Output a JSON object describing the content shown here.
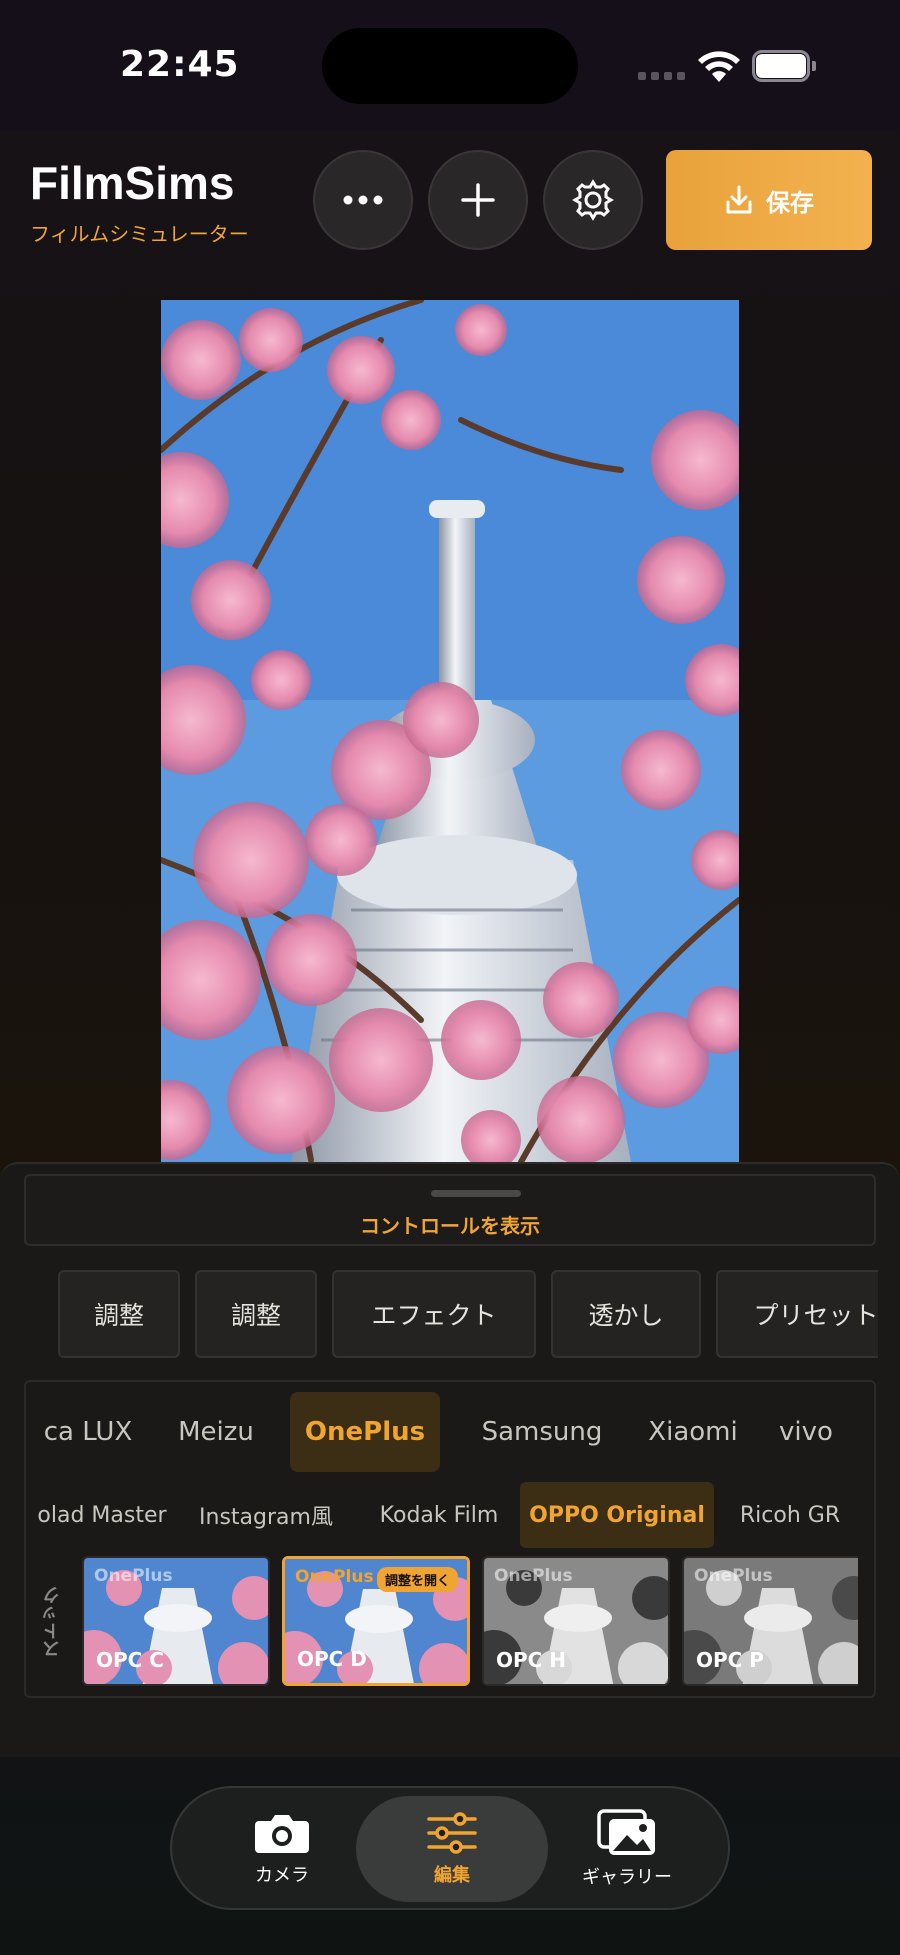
{
  "status": {
    "time": "22:45"
  },
  "header": {
    "title": "FilmSims",
    "subtitle": "フィルムシミュレーター",
    "save_label": "保存"
  },
  "icons": [
    "more-icon",
    "plus-icon",
    "gear-icon",
    "download-icon",
    "camera-icon",
    "sliders-icon",
    "gallery-icon"
  ],
  "controls": {
    "show_label": "コントロールを表示"
  },
  "tabs": [
    "調整",
    "調整",
    "エフェクト",
    "透かし",
    "プリセット"
  ],
  "brands": [
    "ca LUX",
    "Meizu",
    "OnePlus",
    "Samsung",
    "Xiaomi",
    "vivo"
  ],
  "brand_selected": "OnePlus",
  "categories": [
    "olad Master",
    "Instagram風",
    "Kodak Film",
    "OPPO Original",
    "Ricoh GR"
  ],
  "category_selected": "OPPO Original",
  "filters": {
    "label": "ストック",
    "open_badge": "調整を開く",
    "items": [
      {
        "brand": "OnePlus",
        "name": "OPC C"
      },
      {
        "brand": "OnePlus",
        "name": "OPC D"
      },
      {
        "brand": "OnePlus",
        "name": "OPC H"
      },
      {
        "brand": "OnePlus",
        "name": "OPC P"
      }
    ],
    "selected": "OPC D"
  },
  "nav": {
    "items": [
      "カメラ",
      "編集",
      "ギャラリー"
    ],
    "active": "編集"
  },
  "colors": {
    "accent": "#f0a431",
    "background": "#161218"
  }
}
